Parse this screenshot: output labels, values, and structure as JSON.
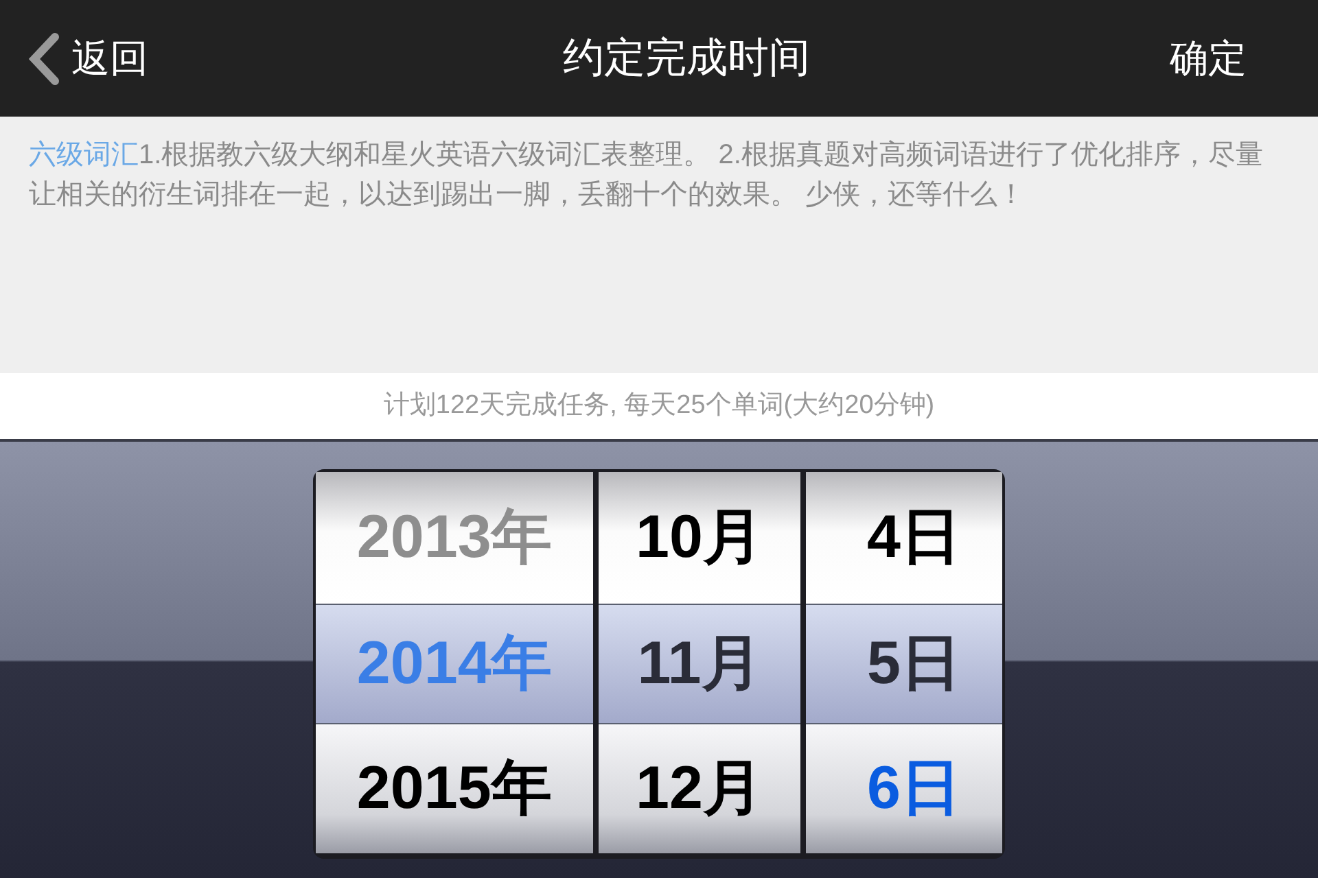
{
  "nav_bar": {
    "back": "返回",
    "title": "约定完成时间",
    "confirm": "确定"
  },
  "description": {
    "link": "六级词汇",
    "text": "1.根据教六级大纲和星火英语六级词汇表整理。 2.根据真题对高频词语进行了优化排序，尽量让相关的衍生词排在一起，以达到踢出一脚，丢翻十个的效果。 少侠，还等什么！"
  },
  "plan_summary": "计划122天完成任务, 每天25个单词(大约20分钟)",
  "date_picker": {
    "columns": [
      {
        "items": [
          {
            "text": "2013年",
            "selected": false,
            "color": "#8e8e8e"
          },
          {
            "text": "2014年",
            "selected": true,
            "color": "#3a7ee6"
          },
          {
            "text": "2015年",
            "selected": false,
            "color": "#000000"
          }
        ]
      },
      {
        "items": [
          {
            "text": "10月",
            "selected": false,
            "color": "#000000"
          },
          {
            "text": "11月",
            "selected": true,
            "color": "#2a2c38"
          },
          {
            "text": "12月",
            "selected": false,
            "color": "#000000"
          }
        ]
      },
      {
        "items": [
          {
            "text": "4日",
            "selected": false,
            "color": "#000000"
          },
          {
            "text": "5日",
            "selected": true,
            "color": "#2a2c38"
          },
          {
            "text": "6日",
            "selected": false,
            "color": "#0a5ce0"
          }
        ]
      }
    ]
  }
}
